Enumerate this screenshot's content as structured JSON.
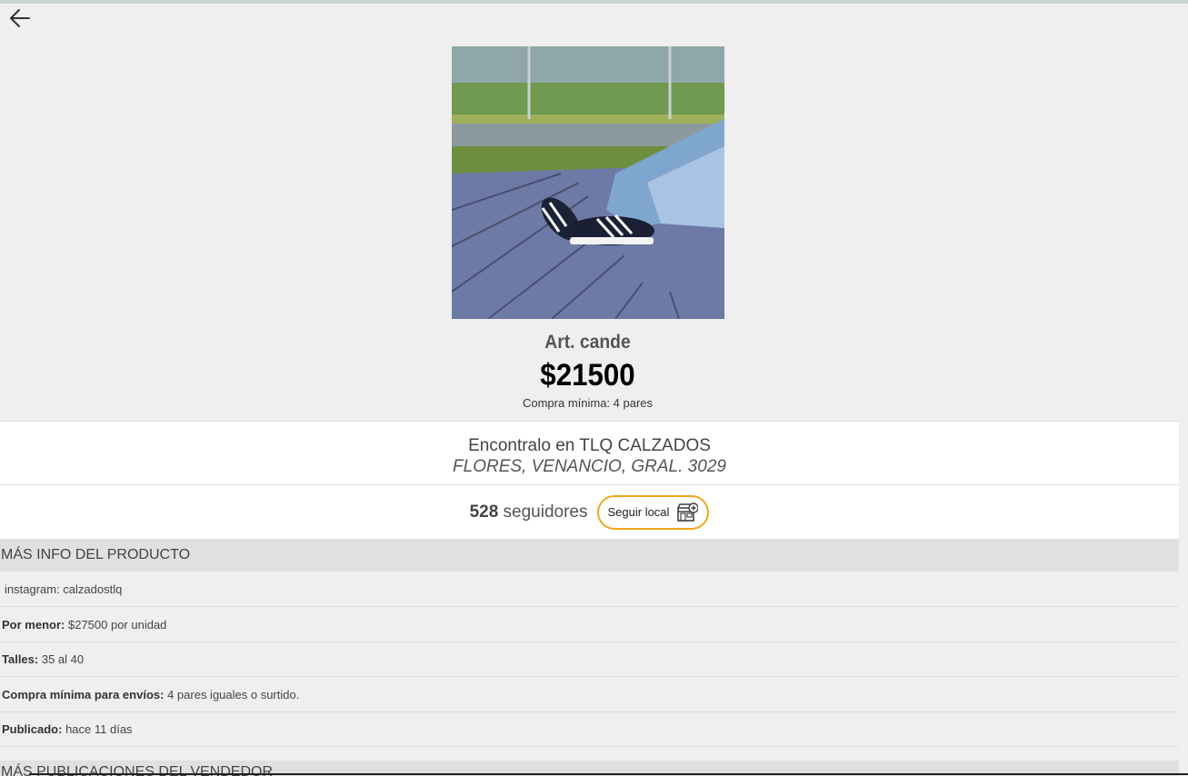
{
  "product": {
    "title": "Art. cande",
    "price": "$21500",
    "min_purchase": "Compra mínima: 4 pares"
  },
  "store": {
    "found_in": "Encontralo en TLQ CALZADOS",
    "address": "FLORES, VENANCIO, GRAL. 3029",
    "followers_count": "528",
    "followers_label": "seguidores",
    "follow_button": "Seguir local"
  },
  "info": {
    "header": "MÁS INFO DEL PRODUCTO",
    "instagram": "instagram: calzadostlq",
    "retail_label": "Por menor:",
    "retail_value": "$27500 por unidad",
    "sizes_label": "Talles:",
    "sizes_value": "35 al 40",
    "shipping_label": "Compra mínima para envíos:",
    "shipping_value": "4 pares iguales o surtido.",
    "published_label": "Publicado:",
    "published_value": "hace 11 días"
  },
  "more": {
    "header": "MÁS PUBLICACIONES DEL VENDEDOR"
  },
  "icons": {
    "back": "arrow-left-icon",
    "follow": "store-add-icon"
  },
  "colors": {
    "accent": "#f0a81c",
    "background": "#efefef"
  }
}
